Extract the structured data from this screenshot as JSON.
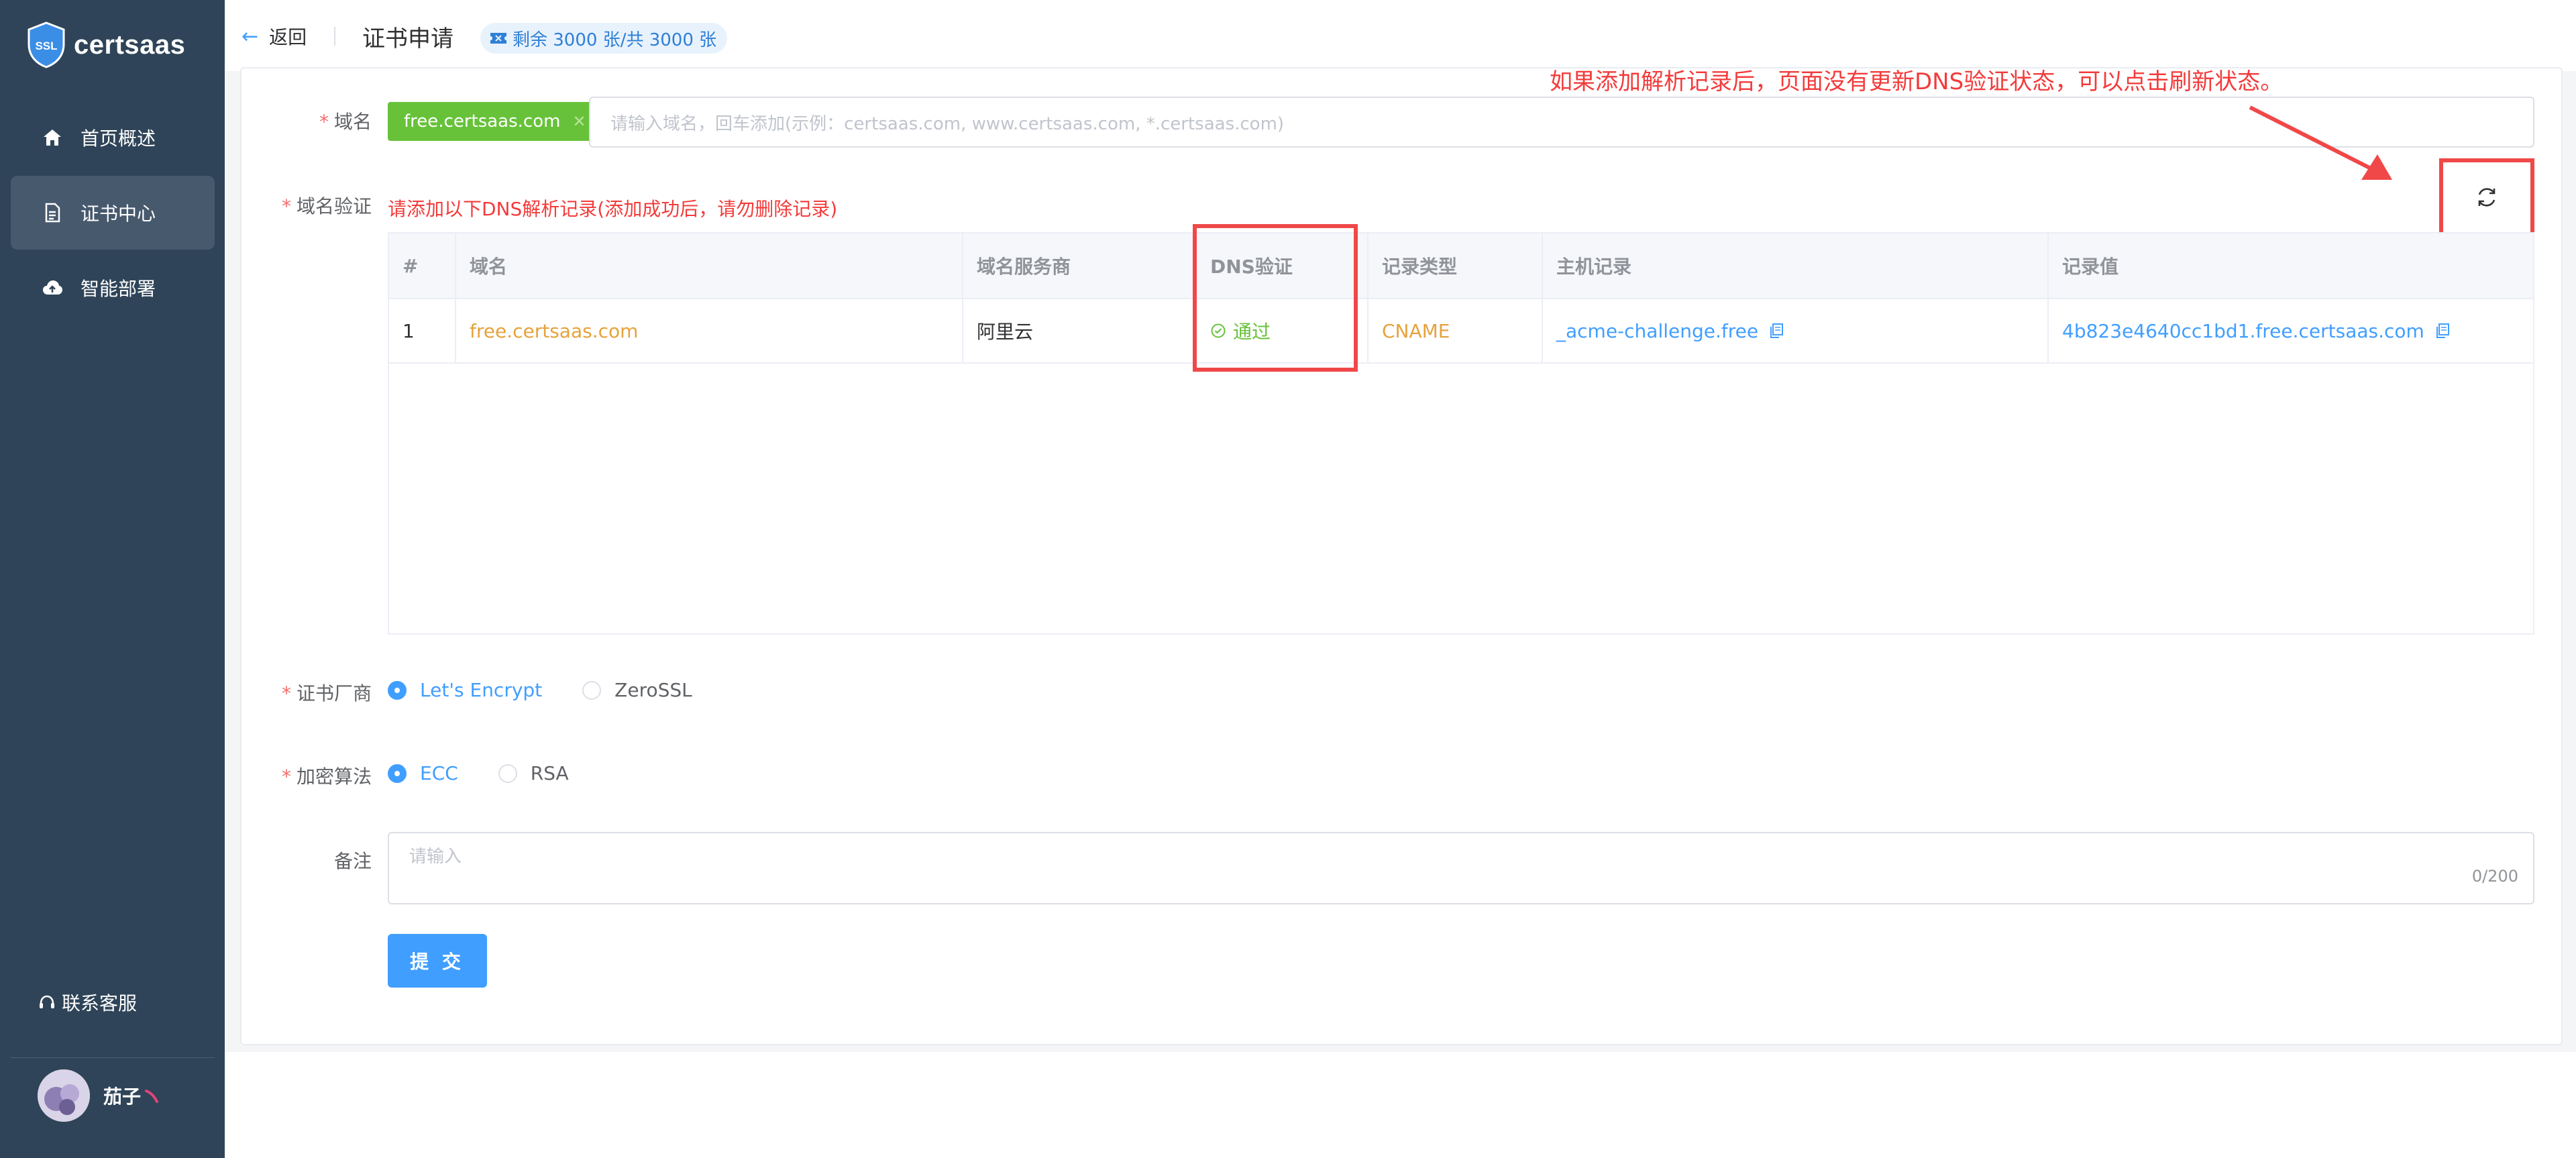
{
  "app": {
    "logo_text": "certsaas",
    "logo_badge": "SSL"
  },
  "sidebar": {
    "items": [
      {
        "label": "首页概述",
        "icon": "home-icon",
        "active": false
      },
      {
        "label": "证书中心",
        "icon": "document-icon",
        "active": true
      },
      {
        "label": "智能部署",
        "icon": "cloud-upload-icon",
        "active": false
      }
    ],
    "support_label": "联系客服",
    "user_name": "茄子"
  },
  "header": {
    "back_label": "返回",
    "title": "证书申请",
    "quota_label": "剩余 3000 张/共 3000 张"
  },
  "form": {
    "domain_label": "域名",
    "domain_tag": "free.certsaas.com",
    "domain_placeholder": "请输入域名，回车添加(示例：certsaas.com, www.certsaas.com, *.certsaas.com)",
    "verify_label": "域名验证",
    "verify_hint": "请添加以下DNS解析记录(添加成功后，请勿删除记录)",
    "annotation": "如果添加解析记录后，页面没有更新DNS验证状态，可以点击刷新状态。",
    "table": {
      "headers": [
        "#",
        "域名",
        "域名服务商",
        "DNS验证",
        "记录类型",
        "主机记录",
        "记录值"
      ],
      "rows": [
        {
          "index": "1",
          "domain": "free.certsaas.com",
          "provider": "阿里云",
          "dns_status": "通过",
          "record_type": "CNAME",
          "host": "_acme-challenge.free",
          "value": "4b823e4640cc1bd1.free.certsaas.com"
        }
      ]
    },
    "vendor_label": "证书厂商",
    "vendor_options": [
      "Let's Encrypt",
      "ZeroSSL"
    ],
    "vendor_selected": "Let's Encrypt",
    "algo_label": "加密算法",
    "algo_options": [
      "ECC",
      "RSA"
    ],
    "algo_selected": "ECC",
    "remark_label": "备注",
    "remark_placeholder": "请输入",
    "remark_counter": "0/200",
    "submit_label": "提 交"
  },
  "colors": {
    "sidebar_bg": "#2f4458",
    "accent": "#409eff",
    "success": "#67c23a",
    "warning": "#e6a23c",
    "annotation_red": "#f33b3b"
  }
}
